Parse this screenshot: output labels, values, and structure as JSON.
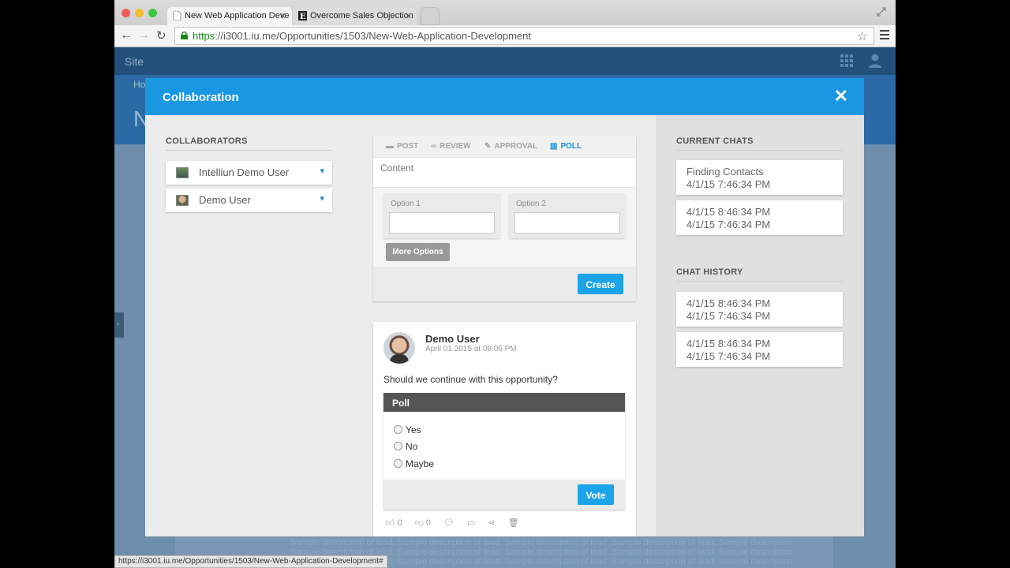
{
  "browser": {
    "tabs": [
      {
        "title": "New Web Application Deve",
        "close": "×"
      },
      {
        "title": "Overcome Sales Objection",
        "close": "×"
      }
    ],
    "url_scheme": "https",
    "url_rest": "://i3001.iu.me/Opportunities/1503/New-Web-Application-Development",
    "status_url": "https://i3001.iu.me/Opportunities/1503/New-Web-Application-Development#"
  },
  "background_page": {
    "site": "Site",
    "home_fragment": "Ho",
    "title_fragment": "N",
    "sample_text": "Sample description of lead. Sample description of lead. Sample description of lead. Sample description of lead. Sample description of lead."
  },
  "modal": {
    "title": "Collaboration",
    "close": "✕"
  },
  "collaborators": {
    "heading": "COLLABORATORS",
    "items": [
      {
        "name": "Intelliun Demo User"
      },
      {
        "name": "Demo User"
      }
    ]
  },
  "composer": {
    "tabs": [
      {
        "label": "POST",
        "icon": "post-icon"
      },
      {
        "label": "REVIEW",
        "icon": "review-icon"
      },
      {
        "label": "APPROVAL",
        "icon": "approval-icon"
      },
      {
        "label": "POLL",
        "icon": "poll-icon",
        "active": true
      }
    ],
    "content_placeholder": "Content",
    "option1_label": "Option 1",
    "option2_label": "Option 2",
    "more_options": "More Options",
    "create": "Create"
  },
  "post": {
    "author": "Demo User",
    "date": "April 01 2015 at 08:06 PM",
    "question": "Should we continue with this opportunity?",
    "poll_title": "Poll",
    "options": [
      "Yes",
      "No",
      "Maybe"
    ],
    "vote": "Vote",
    "likes": "0",
    "dislikes": "0"
  },
  "current_chats": {
    "heading": "CURRENT CHATS",
    "items": [
      {
        "line1": "Finding Contacts",
        "line2": "4/1/15 7:46:34 PM"
      },
      {
        "line1": "4/1/15 8:46:34 PM",
        "line2": "4/1/15 7:46:34 PM"
      }
    ]
  },
  "chat_history": {
    "heading": "CHAT HISTORY",
    "items": [
      {
        "line1": "4/1/15 8:46:34 PM",
        "line2": "4/1/15 7:46:34 PM"
      },
      {
        "line1": "4/1/15 8:46:34 PM",
        "line2": "4/1/15 7:46:34 PM"
      }
    ]
  },
  "colors": {
    "header_blue": "#1997e0",
    "button_blue": "#1ba4e8",
    "poll_header": "#555555"
  }
}
